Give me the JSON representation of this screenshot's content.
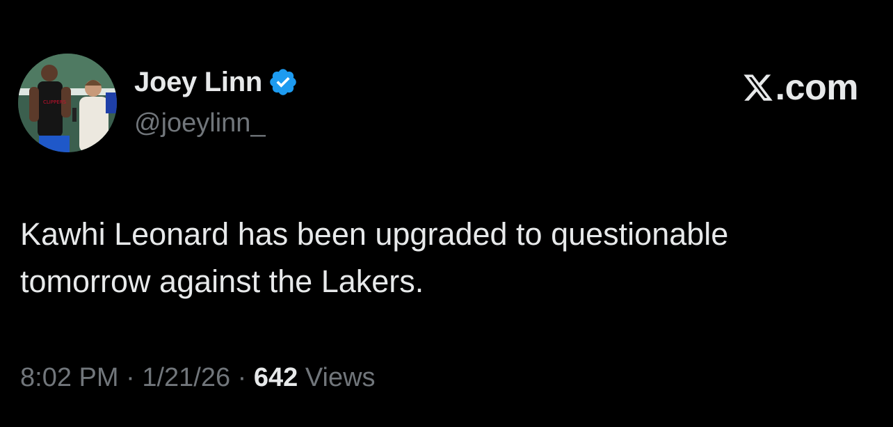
{
  "header": {
    "display_name": "Joey Linn",
    "handle": "@joeylinn_",
    "verified_icon": "verified-badge-icon",
    "verified_color": "#1d9bf0"
  },
  "brand": {
    "icon": "x-logo-icon",
    "suffix": ".com"
  },
  "tweet": {
    "text_line_1": "Kawhi Leonard has been upgraded to questionable",
    "text_line_2": "tomorrow against the Lakers."
  },
  "meta": {
    "time": "8:02 PM",
    "separator": "·",
    "date": "1/21/26",
    "views_count": "642",
    "views_label": "Views"
  },
  "colors": {
    "background": "#000000",
    "primary_text": "#e7e9ea",
    "secondary_text": "#71767b"
  }
}
